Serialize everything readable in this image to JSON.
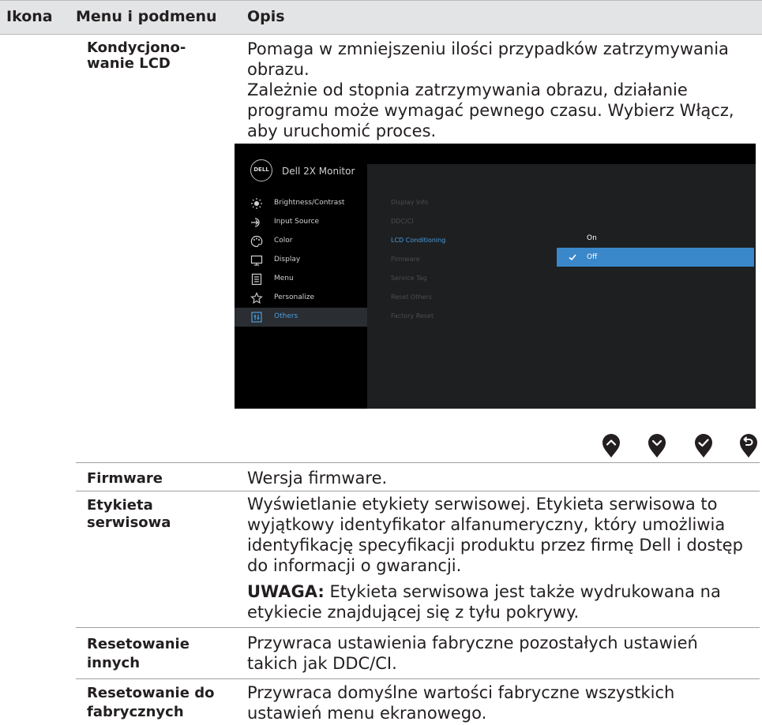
{
  "header": {
    "col_icon": "Ikona",
    "col_menu": "Menu i podmenu",
    "col_desc": "Opis"
  },
  "rows": [
    {
      "label_lines": [
        "Kondycjono-",
        "wanie LCD"
      ],
      "desc_lines": [
        "Pomaga w zmniejszeniu ilości przypadków zatrzymywania",
        "obrazu.",
        "Zależnie od stopnia zatrzymywania obrazu, działanie",
        "programu może wymagać pewnego czasu. Wybierz Włącz,",
        "aby uruchomić proces."
      ]
    },
    {
      "label": "Firmware",
      "desc": "Wersja firmware."
    },
    {
      "label_lines": [
        "Etykieta",
        "serwisowa"
      ],
      "desc_lines": [
        "Wyświetlanie etykiety serwisowej. Etykieta serwisowa to",
        "wyjątkowy identyfikator alfanumeryczny, który umożliwia",
        "identyfikację specyfikacji produktu przez firmę Dell i dostęp",
        "do informacji o gwarancji."
      ],
      "note_label": "UWAGA:",
      "note_lines": [
        " Etykieta serwisowa jest także wydrukowana na",
        "etykiecie znajdującej się z tyłu pokrywy."
      ]
    },
    {
      "label_lines": [
        "Resetowanie",
        "innych"
      ],
      "desc_lines": [
        "Przywraca ustawienia fabryczne pozostałych ustawień",
        "takich jak DDC/CI."
      ]
    },
    {
      "label_lines": [
        "Resetowanie do",
        "fabrycznych"
      ],
      "desc_lines": [
        "Przywraca domyślne wartości fabryczne wszystkich",
        "ustawień menu ekranowego."
      ]
    }
  ],
  "osd": {
    "logo": "DELL",
    "title": "Dell 2X Monitor",
    "menu": [
      {
        "label": "Brightness/Contrast",
        "icon": "brightness-icon"
      },
      {
        "label": "Input Source",
        "icon": "input-source-icon"
      },
      {
        "label": "Color",
        "icon": "color-icon"
      },
      {
        "label": "Display",
        "icon": "display-icon"
      },
      {
        "label": "Menu",
        "icon": "menu-icon"
      },
      {
        "label": "Personalize",
        "icon": "star-icon"
      },
      {
        "label": "Others",
        "icon": "others-icon",
        "active": true
      }
    ],
    "submenu": [
      "Display Info",
      "DDC/CI",
      "LCD Conditioning",
      "Firmware",
      "Service Tag",
      "Reset Others",
      "Factory Reset"
    ],
    "active_submenu": "LCD Conditioning",
    "options": [
      {
        "label": "On",
        "selected": false
      },
      {
        "label": "Off",
        "selected": true
      }
    ]
  },
  "nav_buttons": [
    "up-button-icon",
    "down-button-icon",
    "ok-button-icon",
    "back-button-icon"
  ],
  "colors": {
    "header_bg": "#e3e4e5",
    "osd_accent": "#3a87c9",
    "osd_active_text": "#4a9fe0"
  }
}
